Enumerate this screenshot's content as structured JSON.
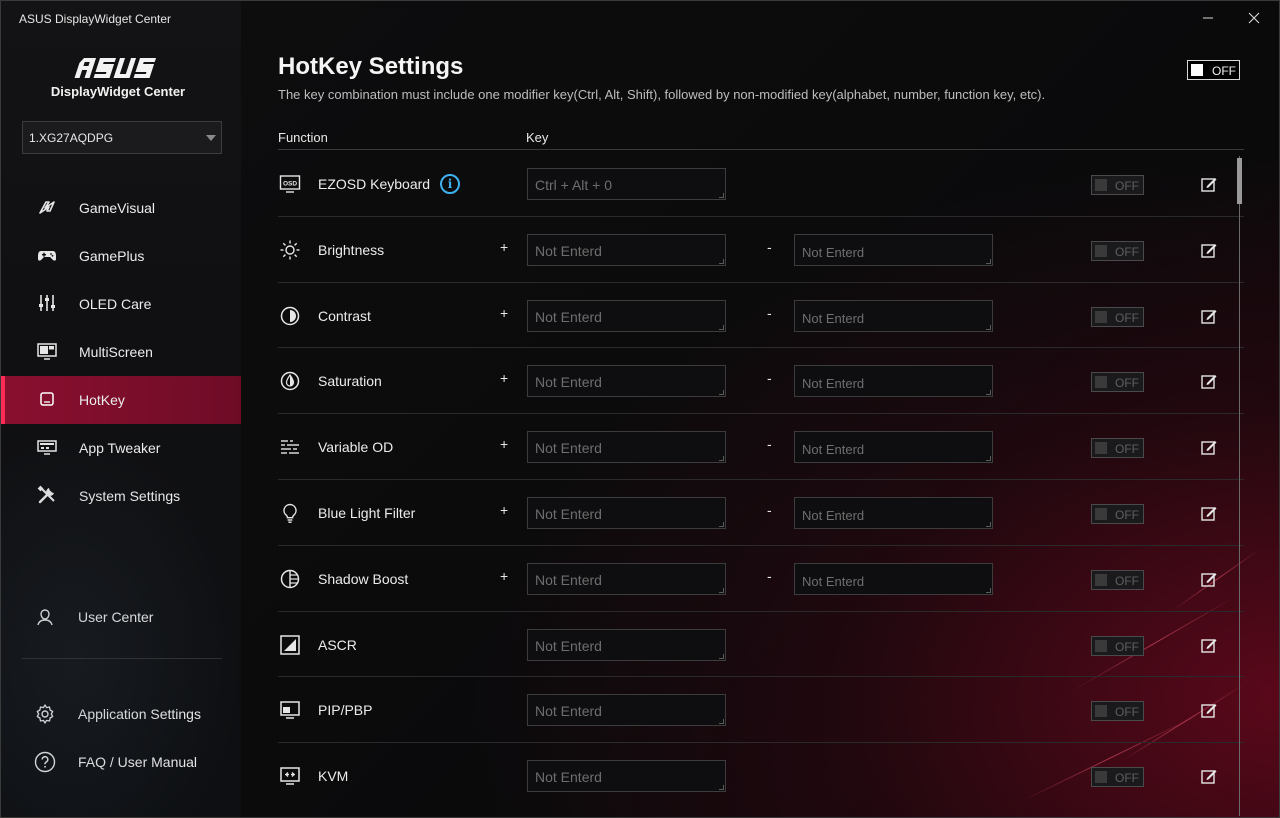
{
  "window": {
    "title": "ASUS DisplayWidget Center"
  },
  "sidebar": {
    "logo_text": "ASUS",
    "subtitle": "DisplayWidget Center",
    "monitor": "1.XG27AQDPG",
    "items": [
      {
        "label": "GameVisual",
        "icon": "gamevisual-icon"
      },
      {
        "label": "GamePlus",
        "icon": "gamepad-icon"
      },
      {
        "label": "OLED Care",
        "icon": "sliders-icon"
      },
      {
        "label": "MultiScreen",
        "icon": "multiscreen-icon"
      },
      {
        "label": "HotKey",
        "icon": "hotkey-icon",
        "active": true
      },
      {
        "label": "App Tweaker",
        "icon": "app-tweaker-icon"
      },
      {
        "label": "System Settings",
        "icon": "wrench-icon"
      }
    ],
    "user_center": "User Center",
    "app_settings": "Application Settings",
    "faq": "FAQ / User Manual"
  },
  "main": {
    "title": "HotKey Settings",
    "description": "The key combination must include one modifier key(Ctrl, Alt, Shift), followed by non-modified key(alphabet, number, function key, etc).",
    "master_toggle": "OFF",
    "col_function": "Function",
    "col_key": "Key",
    "plus": "+",
    "minus": "-",
    "toggle_label": "OFF",
    "rows": [
      {
        "name": "EZOSD Keyboard",
        "icon": "osd-icon",
        "key1": "Ctrl + Alt + 0",
        "info": "i"
      },
      {
        "name": "Brightness",
        "icon": "sun-icon",
        "key1": "Not Enterd",
        "key2": "Not Enterd"
      },
      {
        "name": "Contrast",
        "icon": "contrast-icon",
        "key1": "Not Enterd",
        "key2": "Not Enterd"
      },
      {
        "name": "Saturation",
        "icon": "saturation-icon",
        "key1": "Not Enterd",
        "key2": "Not Enterd"
      },
      {
        "name": "Variable OD",
        "icon": "variable-od-icon",
        "key1": "Not Enterd",
        "key2": "Not Enterd"
      },
      {
        "name": "Blue Light Filter",
        "icon": "lightbulb-icon",
        "key1": "Not Enterd",
        "key2": "Not Enterd"
      },
      {
        "name": "Shadow Boost",
        "icon": "shadow-boost-icon",
        "key1": "Not Enterd",
        "key2": "Not Enterd"
      },
      {
        "name": "ASCR",
        "icon": "ascr-icon",
        "key1": "Not Enterd"
      },
      {
        "name": "PIP/PBP",
        "icon": "pip-icon",
        "key1": "Not Enterd"
      },
      {
        "name": "KVM",
        "icon": "kvm-icon",
        "key1": "Not Enterd"
      }
    ]
  },
  "colors": {
    "accent": "#8a0f2f",
    "info": "#3fb0f0"
  }
}
